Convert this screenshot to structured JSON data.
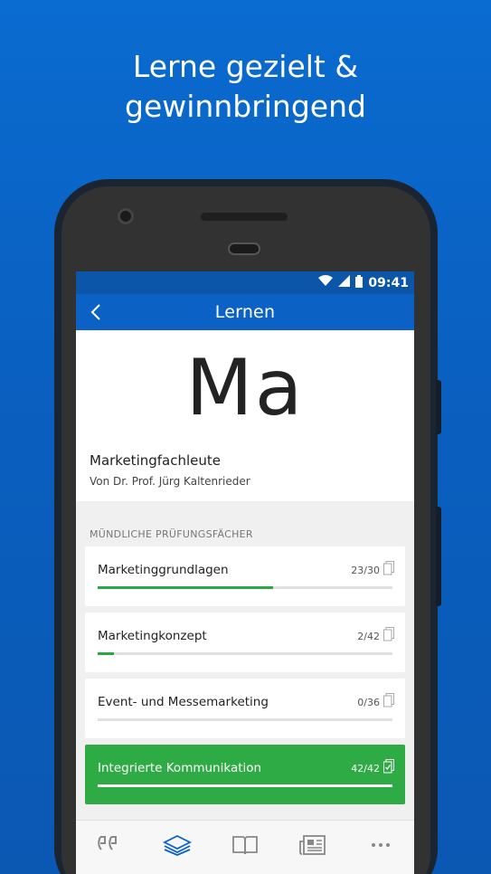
{
  "headline": {
    "line1": "Lerne gezielt &",
    "line2": "gewinnbringend"
  },
  "statusbar": {
    "time": "09:41"
  },
  "appbar": {
    "title": "Lernen"
  },
  "course": {
    "logo": "Ma",
    "name": "Marketingfachleute",
    "author": "Von Dr. Prof. Jürg Kaltenrieder"
  },
  "section": {
    "header": "MÜNDLICHE PRÜFUNGSFÄCHER"
  },
  "subjects": [
    {
      "name": "Marketinggrundlagen",
      "count": "23/30",
      "progress": 0.5947
    },
    {
      "name": "Marketingkonzept",
      "count": "2/42",
      "progress": 0.0563
    },
    {
      "name": "Event- und Messemarketing",
      "count": "0/36",
      "progress": 0.0
    },
    {
      "name": "Integrierte Kommunikation",
      "count": "42/42",
      "progress": 1.0
    }
  ],
  "tabbar": {
    "items": [
      "quote-icon",
      "stack-icon",
      "book-icon",
      "news-icon",
      "more-icon"
    ],
    "active": "stack-icon"
  },
  "colors": {
    "accent": "#0b62c4",
    "success": "#2fab45",
    "statusbar": "#0b56a8"
  }
}
